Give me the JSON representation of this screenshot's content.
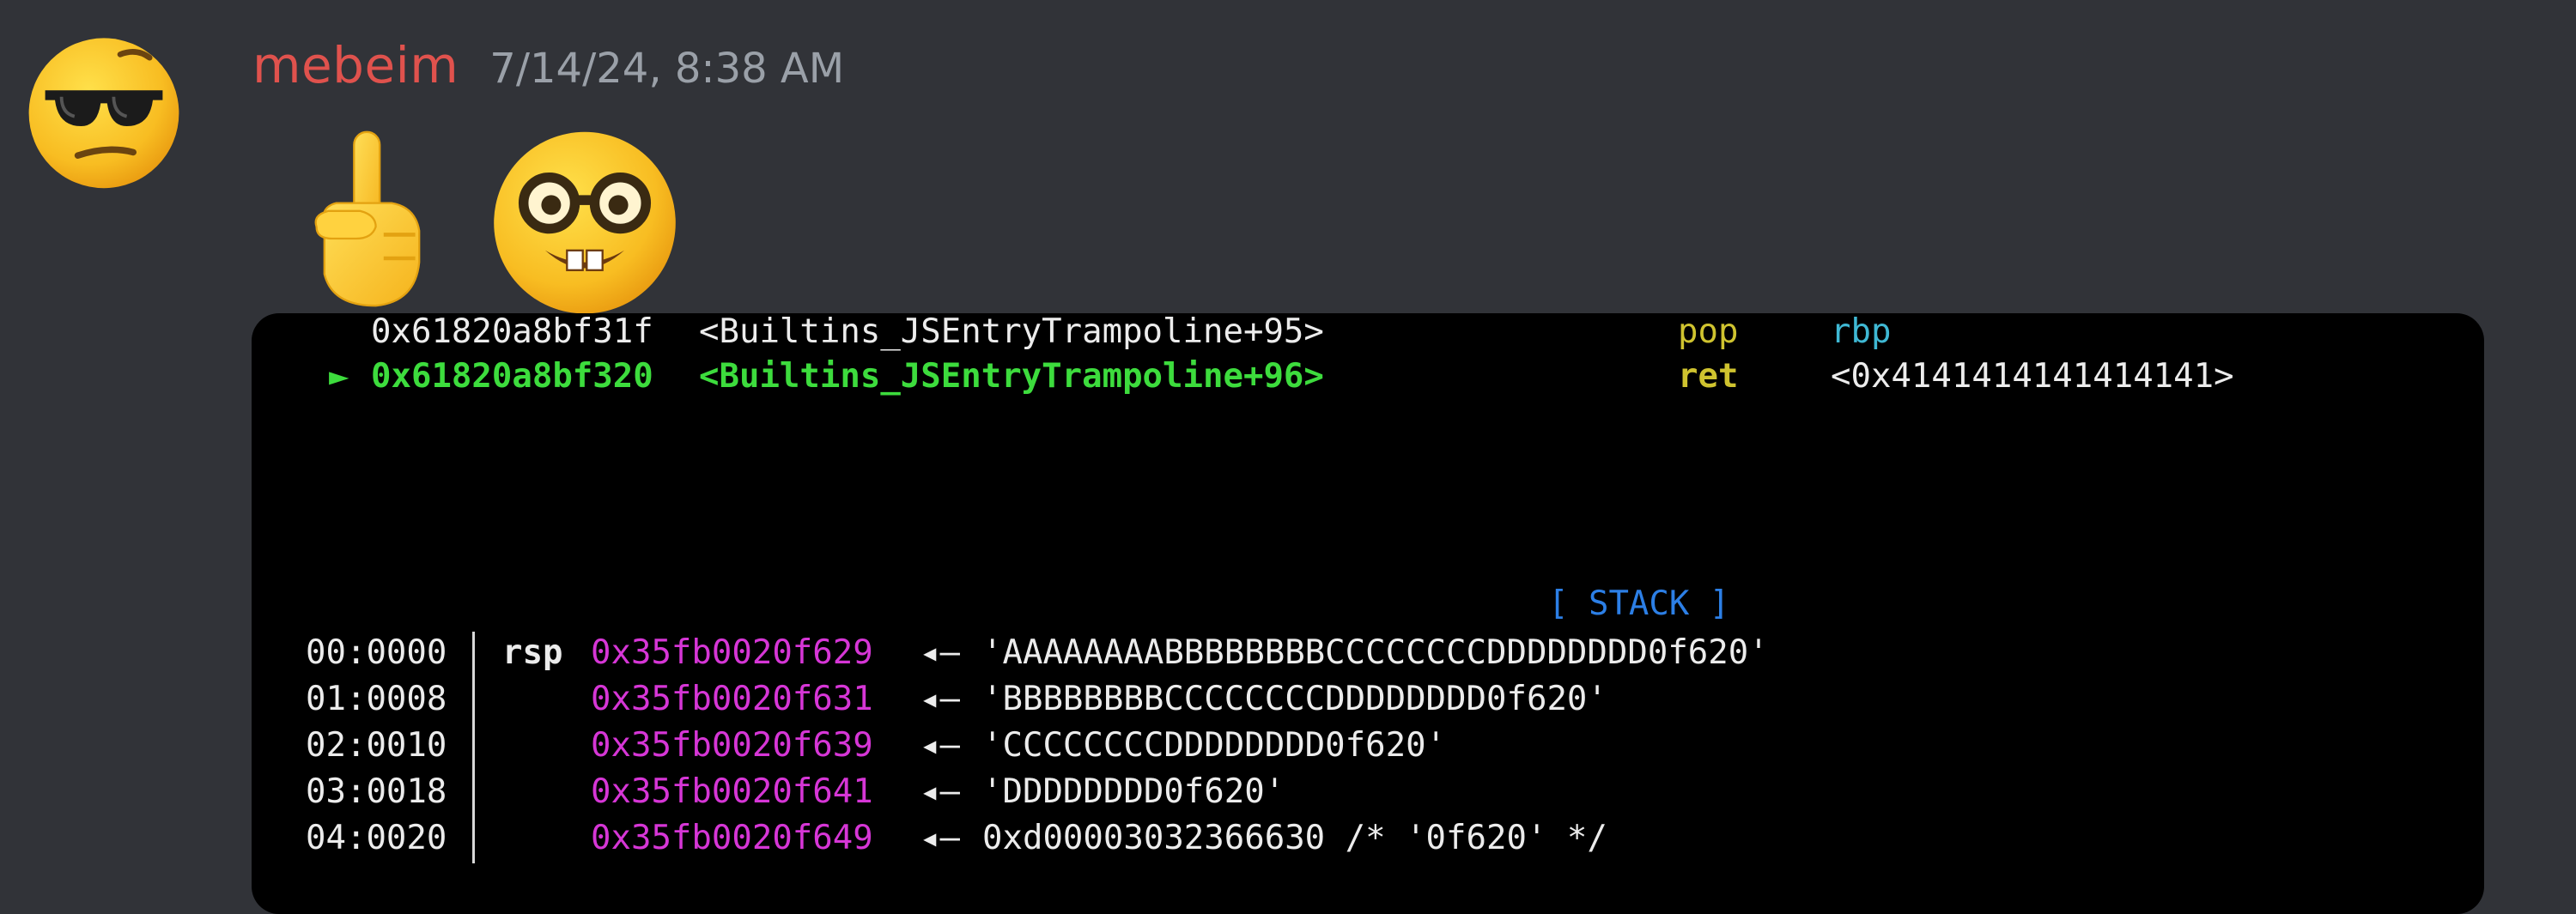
{
  "message": {
    "username": "mebeim",
    "timestamp": "7/14/24, 8:38 AM",
    "avatar_icon": "sunglasses-face-emoji",
    "emojis": [
      "index-pointing-up-emoji",
      "nerd-face-emoji"
    ]
  },
  "terminal": {
    "disasm": [
      {
        "marker": "",
        "addr": "0x61820a8bf31f",
        "sym": "<Builtins_JSEntryTrampoline+95>",
        "op": "pop",
        "arg": "rbp"
      },
      {
        "marker": "►",
        "addr": "0x61820a8bf320",
        "sym": "<Builtins_JSEntryTrampoline+96>",
        "op": "ret",
        "arg": "<0x4141414141414141>"
      }
    ],
    "stack_title": "[ STACK ]",
    "stack": [
      {
        "offset": "00:0000",
        "reg": "rsp",
        "addr": "0x35fb0020f629",
        "arrow": "◂—",
        "value": "'AAAAAAAABBBBBBBBCCCCCCCCDDDDDDDD0f620'"
      },
      {
        "offset": "01:0008",
        "reg": "",
        "addr": "0x35fb0020f631",
        "arrow": "◂—",
        "value": "'BBBBBBBBCCCCCCCCDDDDDDDD0f620'"
      },
      {
        "offset": "02:0010",
        "reg": "",
        "addr": "0x35fb0020f639",
        "arrow": "◂—",
        "value": "'CCCCCCCCDDDDDDDD0f620'"
      },
      {
        "offset": "03:0018",
        "reg": "",
        "addr": "0x35fb0020f641",
        "arrow": "◂—",
        "value": "'DDDDDDDD0f620'"
      },
      {
        "offset": "04:0020",
        "reg": "",
        "addr": "0x35fb0020f649",
        "arrow": "◂—",
        "value": "0xd00003032366630 /* '0f620' */"
      }
    ]
  },
  "colors": {
    "background": "#313338",
    "username": "#e0524d",
    "timestamp": "#9aa0a8",
    "terminal_bg": "#000000",
    "current_line": "#3ddc3d",
    "opcode": "#cfc32f",
    "register": "#3fb8d4",
    "stack_addr": "#d636d6",
    "divider": "#1f5fcc"
  }
}
